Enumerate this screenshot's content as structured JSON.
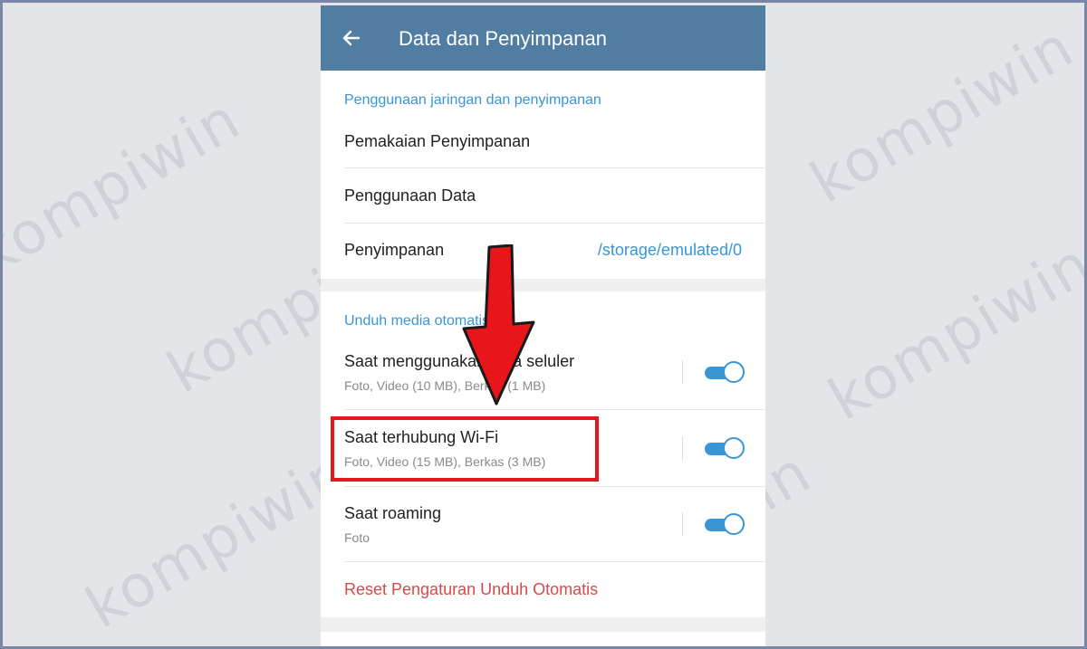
{
  "watermark": "kompiwin",
  "appbar": {
    "title": "Data dan Penyimpanan",
    "back_icon": "arrow-left-icon"
  },
  "network_section": {
    "header": "Penggunaan jaringan dan penyimpanan",
    "items": [
      {
        "label": "Pemakaian Penyimpanan"
      },
      {
        "label": "Penggunaan Data"
      },
      {
        "label": "Penyimpanan",
        "value": "/storage/emulated/0"
      }
    ]
  },
  "autodownload_section": {
    "header": "Unduh media otomatis",
    "items": [
      {
        "label": "Saat menggunakan data seluler",
        "sub": "Foto, Video (10 MB), Berkas (1 MB)",
        "enabled": true
      },
      {
        "label": "Saat terhubung Wi-Fi",
        "sub": "Foto, Video (15 MB), Berkas (3 MB)",
        "enabled": true
      },
      {
        "label": "Saat roaming",
        "sub": "Foto",
        "enabled": true
      }
    ],
    "reset_label": "Reset Pengaturan Unduh Otomatis"
  },
  "colors": {
    "appbar": "#517da2",
    "accent": "#3a95d5",
    "reset": "#d44b4b",
    "highlight": "#e8161b"
  }
}
